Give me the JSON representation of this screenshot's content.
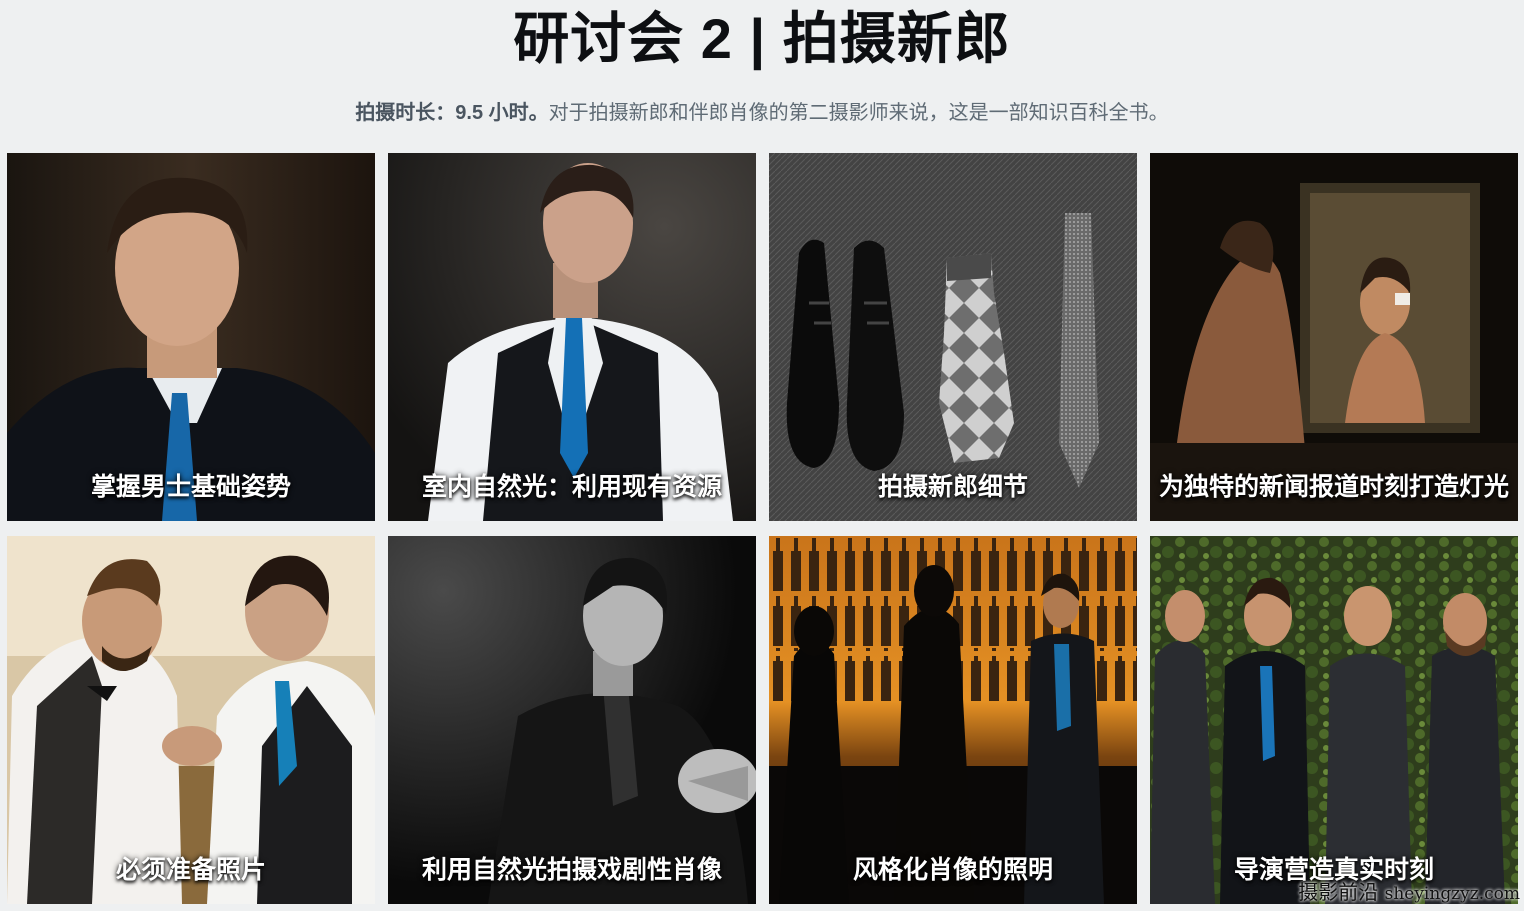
{
  "header": {
    "title": "研讨会 2 | 拍摄新郎",
    "subtitle_strong": "拍摄时长：9.5 小时。",
    "subtitle_rest": "对于拍摄新郎和伴郎肖像的第二摄影师来说，这是一部知识百科全书。"
  },
  "lessons": [
    {
      "caption": "掌握男士基础姿势",
      "image": "groom-portrait-blue-tie"
    },
    {
      "caption": "室内自然光：利用现有资源",
      "image": "groom-vest-window-light"
    },
    {
      "caption": "拍摄新郎细节",
      "image": "shoes-socks-tie-flatlay"
    },
    {
      "caption": "为独特的新闻报道时刻打造灯光",
      "image": "groom-shaving-mirror"
    },
    {
      "caption": "必须准备照片",
      "image": "groomsmen-cufflinks"
    },
    {
      "caption": "利用自然光拍摄戏剧性肖像",
      "image": "bw-dramatic-portrait"
    },
    {
      "caption": "风格化肖像的照明",
      "image": "bar-silhouettes"
    },
    {
      "caption": "导演营造真实时刻",
      "image": "groomsmen-ivy-wall"
    }
  ],
  "watermark": {
    "cn": "摄影前沿",
    "latin": "sheyingzyz.com"
  },
  "colors": {
    "background": "#eef0f1",
    "title": "#0d0f12",
    "subtitle": "#5f6b75"
  }
}
